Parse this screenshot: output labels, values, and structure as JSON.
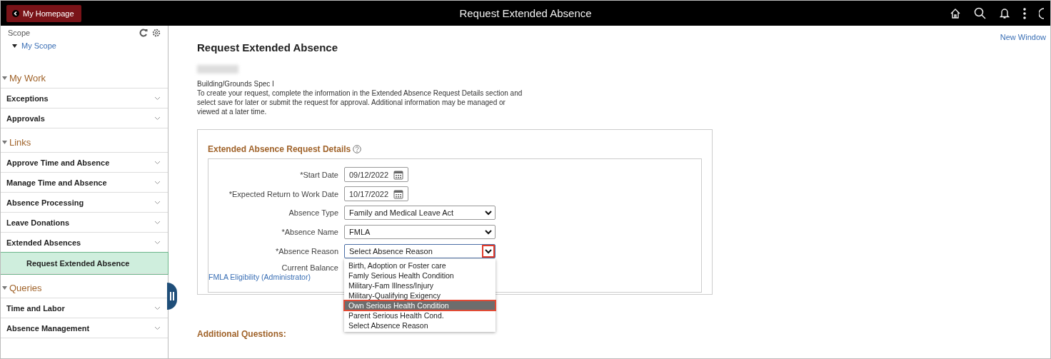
{
  "top_bar": {
    "back_button": "My Homepage",
    "title": "Request Extended Absence"
  },
  "sidebar": {
    "scope_label": "Scope",
    "scope_link": "My Scope",
    "expanded": true,
    "sections": [
      {
        "title": "My Work",
        "expanded": true,
        "items": [
          {
            "label": "Exceptions",
            "kind": "group",
            "selected": false
          },
          {
            "label": "Approvals",
            "kind": "group",
            "selected": false
          }
        ]
      },
      {
        "title": "Links",
        "expanded": true,
        "items": [
          {
            "label": "Approve Time and Absence",
            "kind": "group",
            "selected": false
          },
          {
            "label": "Manage Time and Absence",
            "kind": "group",
            "selected": false
          },
          {
            "label": "Absence Processing",
            "kind": "group",
            "selected": false
          },
          {
            "label": "Leave Donations",
            "kind": "group",
            "selected": false
          },
          {
            "label": "Extended Absences",
            "kind": "group",
            "selected": false
          },
          {
            "label": "Request Extended Absence",
            "kind": "link",
            "selected": true
          }
        ]
      },
      {
        "title": "Queries",
        "expanded": true,
        "items": [
          {
            "label": "Time and Labor",
            "kind": "group",
            "selected": false
          },
          {
            "label": "Absence Management",
            "kind": "group",
            "selected": false
          }
        ]
      }
    ]
  },
  "main": {
    "new_window_link": "New Window",
    "heading": "Request Extended Absence",
    "job_title": "Building/Grounds Spec I",
    "instructions": "To create your request, complete the information in the Extended Absence Request Details section and select save for later or submit the request for approval. Additional information may be managed or viewed at a later time.",
    "details": {
      "title": "Extended Absence Request Details",
      "fields": [
        {
          "label": "*Start Date",
          "kind": "date",
          "value": "09/12/2022"
        },
        {
          "label": "*Expected Return to Work Date",
          "kind": "date",
          "value": "10/17/2022"
        },
        {
          "label": "Absence Type",
          "kind": "select",
          "value": "Family and Medical Leave Act",
          "open": false,
          "arrow_highlighted": false
        },
        {
          "label": "*Absence Name",
          "kind": "select",
          "value": "FMLA",
          "open": false,
          "arrow_highlighted": false
        },
        {
          "label": "*Absence Reason",
          "kind": "select",
          "value": "Select Absence Reason",
          "open": true,
          "arrow_highlighted": true,
          "options": [
            {
              "label": "Birth, Adoption or Foster care",
              "highlighted": false
            },
            {
              "label": "Famly Serious Health Condition",
              "highlighted": false
            },
            {
              "label": "Military-Fam Illness/Injury",
              "highlighted": false
            },
            {
              "label": "Military-Qualifying Exigency",
              "highlighted": false
            },
            {
              "label": "Own Serious Health Condition",
              "highlighted": true
            },
            {
              "label": "Parent Serious Health Cond.",
              "highlighted": false
            },
            {
              "label": "Select Absence Reason",
              "highlighted": false
            }
          ]
        },
        {
          "label": "Current Balance",
          "kind": "text"
        }
      ],
      "eligibility_link": "FMLA Eligibility (Administrator)"
    },
    "additional_title": "Additional Questions:"
  }
}
